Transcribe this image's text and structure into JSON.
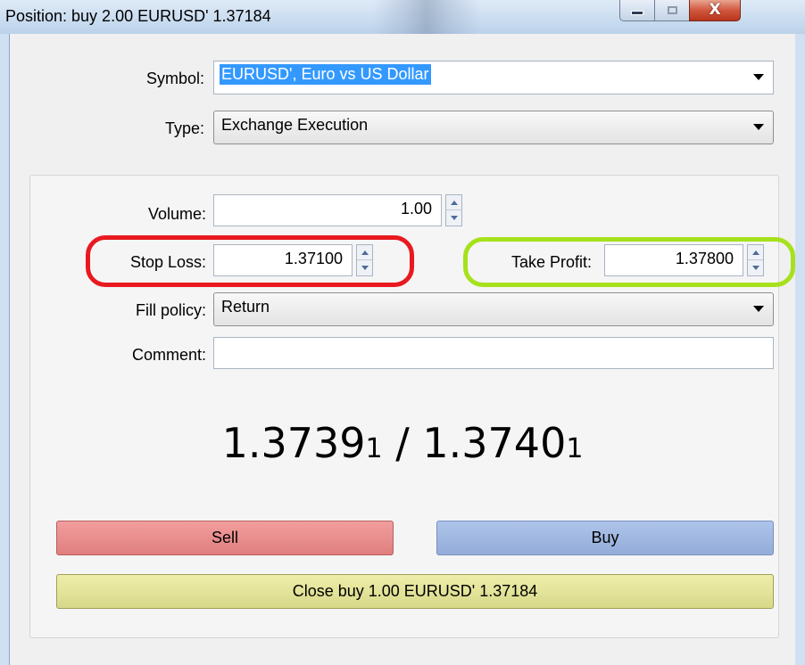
{
  "window": {
    "title": "Position: buy 2.00 EURUSD' 1.37184",
    "controls": {
      "minimize": "minimize-icon",
      "maximize": "maximize-icon",
      "close": "close-icon"
    },
    "close_glyph": "X"
  },
  "form": {
    "symbol_label": "Symbol:",
    "symbol_value": "EURUSD', Euro vs US Dollar",
    "type_label": "Type:",
    "type_value": "Exchange Execution",
    "volume_label": "Volume:",
    "volume_value": "1.00",
    "stop_loss_label": "Stop Loss:",
    "stop_loss_value": "1.37100",
    "take_profit_label": "Take Profit:",
    "take_profit_value": "1.37800",
    "fill_policy_label": "Fill policy:",
    "fill_policy_value": "Return",
    "comment_label": "Comment:",
    "comment_value": ""
  },
  "quote": {
    "bid_main": "1.3739",
    "bid_small": "1",
    "separator": " / ",
    "ask_main": "1.3740",
    "ask_small": "1"
  },
  "buttons": {
    "sell": "Sell",
    "buy": "Buy",
    "close_position": "Close buy 1.00 EURUSD' 1.37184"
  },
  "colors": {
    "stop_loss_ring": "#e8191f",
    "take_profit_ring": "#a6e11c",
    "sell_button": "#e88a8a",
    "buy_button": "#a2b9e2",
    "close_button": "#e4e49a"
  }
}
